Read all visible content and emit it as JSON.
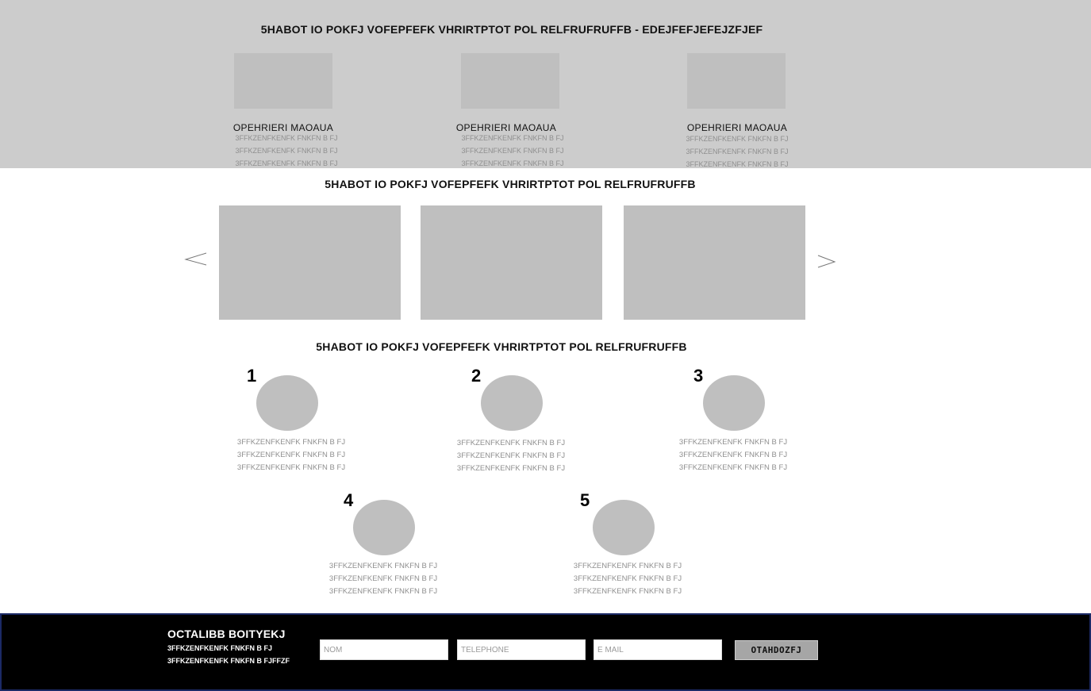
{
  "hero": {
    "title": "5HABOT IO POKFJ VOFEPFEFK VHRIRTPTOT POL RELFRUFRUFFB - EDEJFEFJEFEJZFJEF",
    "features": [
      {
        "heading": "OPEHRIERI MAOAUA",
        "lines": [
          "3FFKZENFKENFK FNKFN B FJ",
          "3FFKZENFKENFK FNKFN B FJ",
          "3FFKZENFKENFK FNKFN B FJ"
        ]
      },
      {
        "heading": "OPEHRIERI MAOAUA",
        "lines": [
          "3FFKZENFKENFK FNKFN B FJ",
          "3FFKZENFKENFK FNKFN B FJ",
          "3FFKZENFKENFK FNKFN B FJ"
        ]
      },
      {
        "heading": "OPEHRIERI MAOAUA",
        "lines": [
          "3FFKZENFKENFK FNKFN B FJ",
          "3FFKZENFKENFK FNKFN B FJ",
          "3FFKZENFKENFK FNKFN B FJ"
        ]
      }
    ]
  },
  "carousel": {
    "title": "5HABOT IO POKFJ VOFEPFEFK VHRIRTPTOT POL RELFRUFRUFFB",
    "prev_icon": "chevron-left-icon",
    "next_icon": "chevron-right-icon"
  },
  "steps": {
    "title": "5HABOT IO POKFJ VOFEPFEFK VHRIRTPTOT POL RELFRUFRUFFB",
    "items": [
      {
        "number": "1",
        "lines": [
          "3FFKZENFKENFK FNKFN B FJ",
          "3FFKZENFKENFK FNKFN B FJ",
          "3FFKZENFKENFK FNKFN B FJ"
        ]
      },
      {
        "number": "2",
        "lines": [
          "3FFKZENFKENFK FNKFN B FJ",
          "3FFKZENFKENFK FNKFN B FJ",
          "3FFKZENFKENFK FNKFN B FJ"
        ]
      },
      {
        "number": "3",
        "lines": [
          "3FFKZENFKENFK FNKFN B FJ",
          "3FFKZENFKENFK FNKFN B FJ",
          "3FFKZENFKENFK FNKFN B FJ"
        ]
      },
      {
        "number": "4",
        "lines": [
          "3FFKZENFKENFK FNKFN B FJ",
          "3FFKZENFKENFK FNKFN B FJ",
          "3FFKZENFKENFK FNKFN B FJ"
        ]
      },
      {
        "number": "5",
        "lines": [
          "3FFKZENFKENFK FNKFN B FJ",
          "3FFKZENFKENFK FNKFN B FJ",
          "3FFKZENFKENFK FNKFN B FJ"
        ]
      }
    ]
  },
  "footer": {
    "title": "OCTALIBB BOITYEKJ",
    "line1": "3FFKZENFKENFK FNKFN B FJ",
    "line2": "3FFKZENFKENFK FNKFN B FJFFZF",
    "name_placeholder": "NOM",
    "phone_placeholder": "TELEPHONE",
    "email_placeholder": "E MAIL",
    "submit_label": "OTAHDOZFJ"
  },
  "colors": {
    "band": "#cccccc",
    "placeholder": "#bfbfbf",
    "muted_text": "#8f8f8f",
    "footer_bg": "#000000",
    "footer_border": "#1c2a66",
    "button_bg": "#a6a6a6"
  }
}
